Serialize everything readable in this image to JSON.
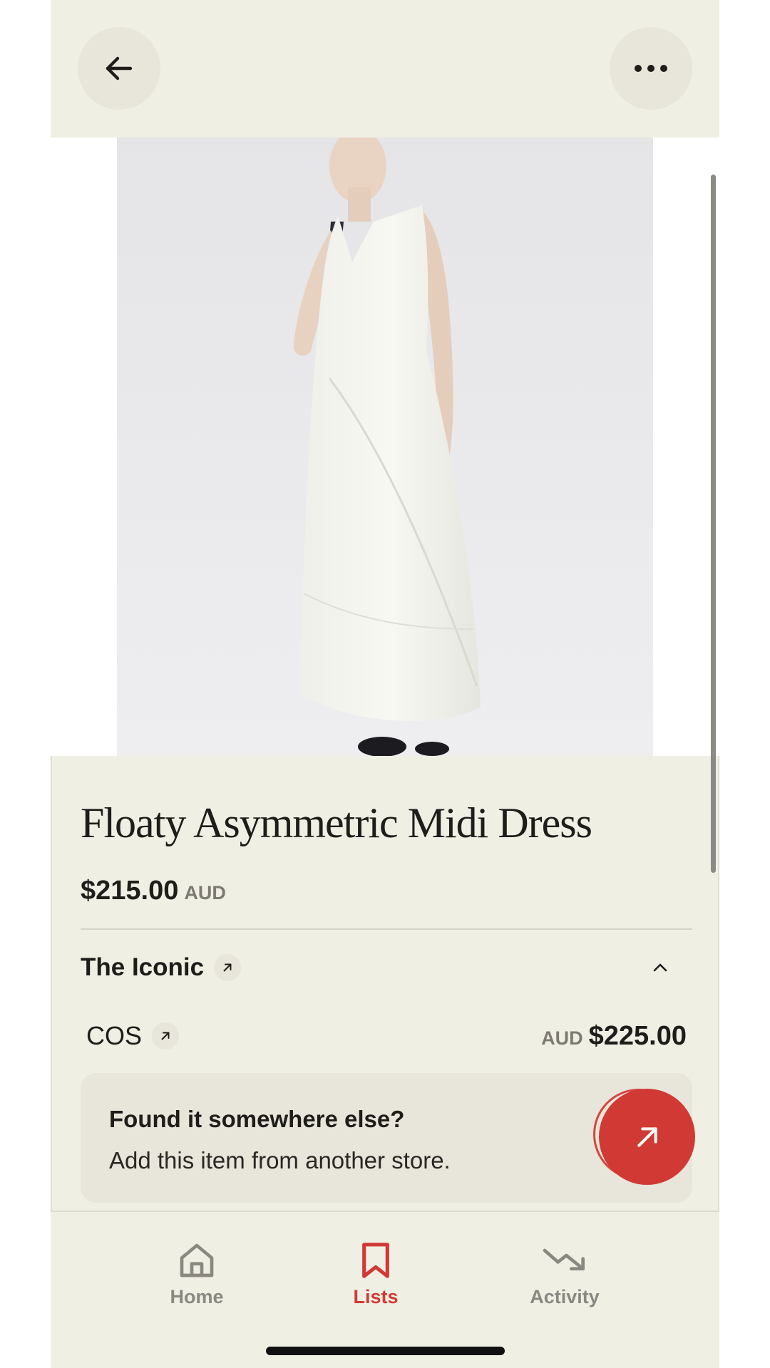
{
  "topbar": {
    "back_icon": "arrow-left-icon",
    "more_icon": "more-horizontal-icon"
  },
  "product": {
    "image": "product-photo-white-dress",
    "title": "Floaty Asymmetric Midi Dress",
    "price": "$215.00",
    "currency": "AUD"
  },
  "store": {
    "name": "The Iconic",
    "link_icon": "arrow-up-right-icon",
    "expand_icon": "chevron-up-icon"
  },
  "offers": [
    {
      "store": "COS",
      "currency": "AUD",
      "price": "$225.00"
    }
  ],
  "found_card": {
    "title": "Found it somewhere else?",
    "subtitle": "Add this item from another store.",
    "action_icon": "arrow-up-right-icon"
  },
  "nav": {
    "items": [
      {
        "label": "Home",
        "icon": "home-icon",
        "active": false
      },
      {
        "label": "Lists",
        "icon": "bookmark-icon",
        "active": true
      },
      {
        "label": "Activity",
        "icon": "trending-down-icon",
        "active": false
      }
    ]
  },
  "colors": {
    "background": "#f0efe4",
    "accent": "#d13a34",
    "muted": "#8a8880"
  }
}
